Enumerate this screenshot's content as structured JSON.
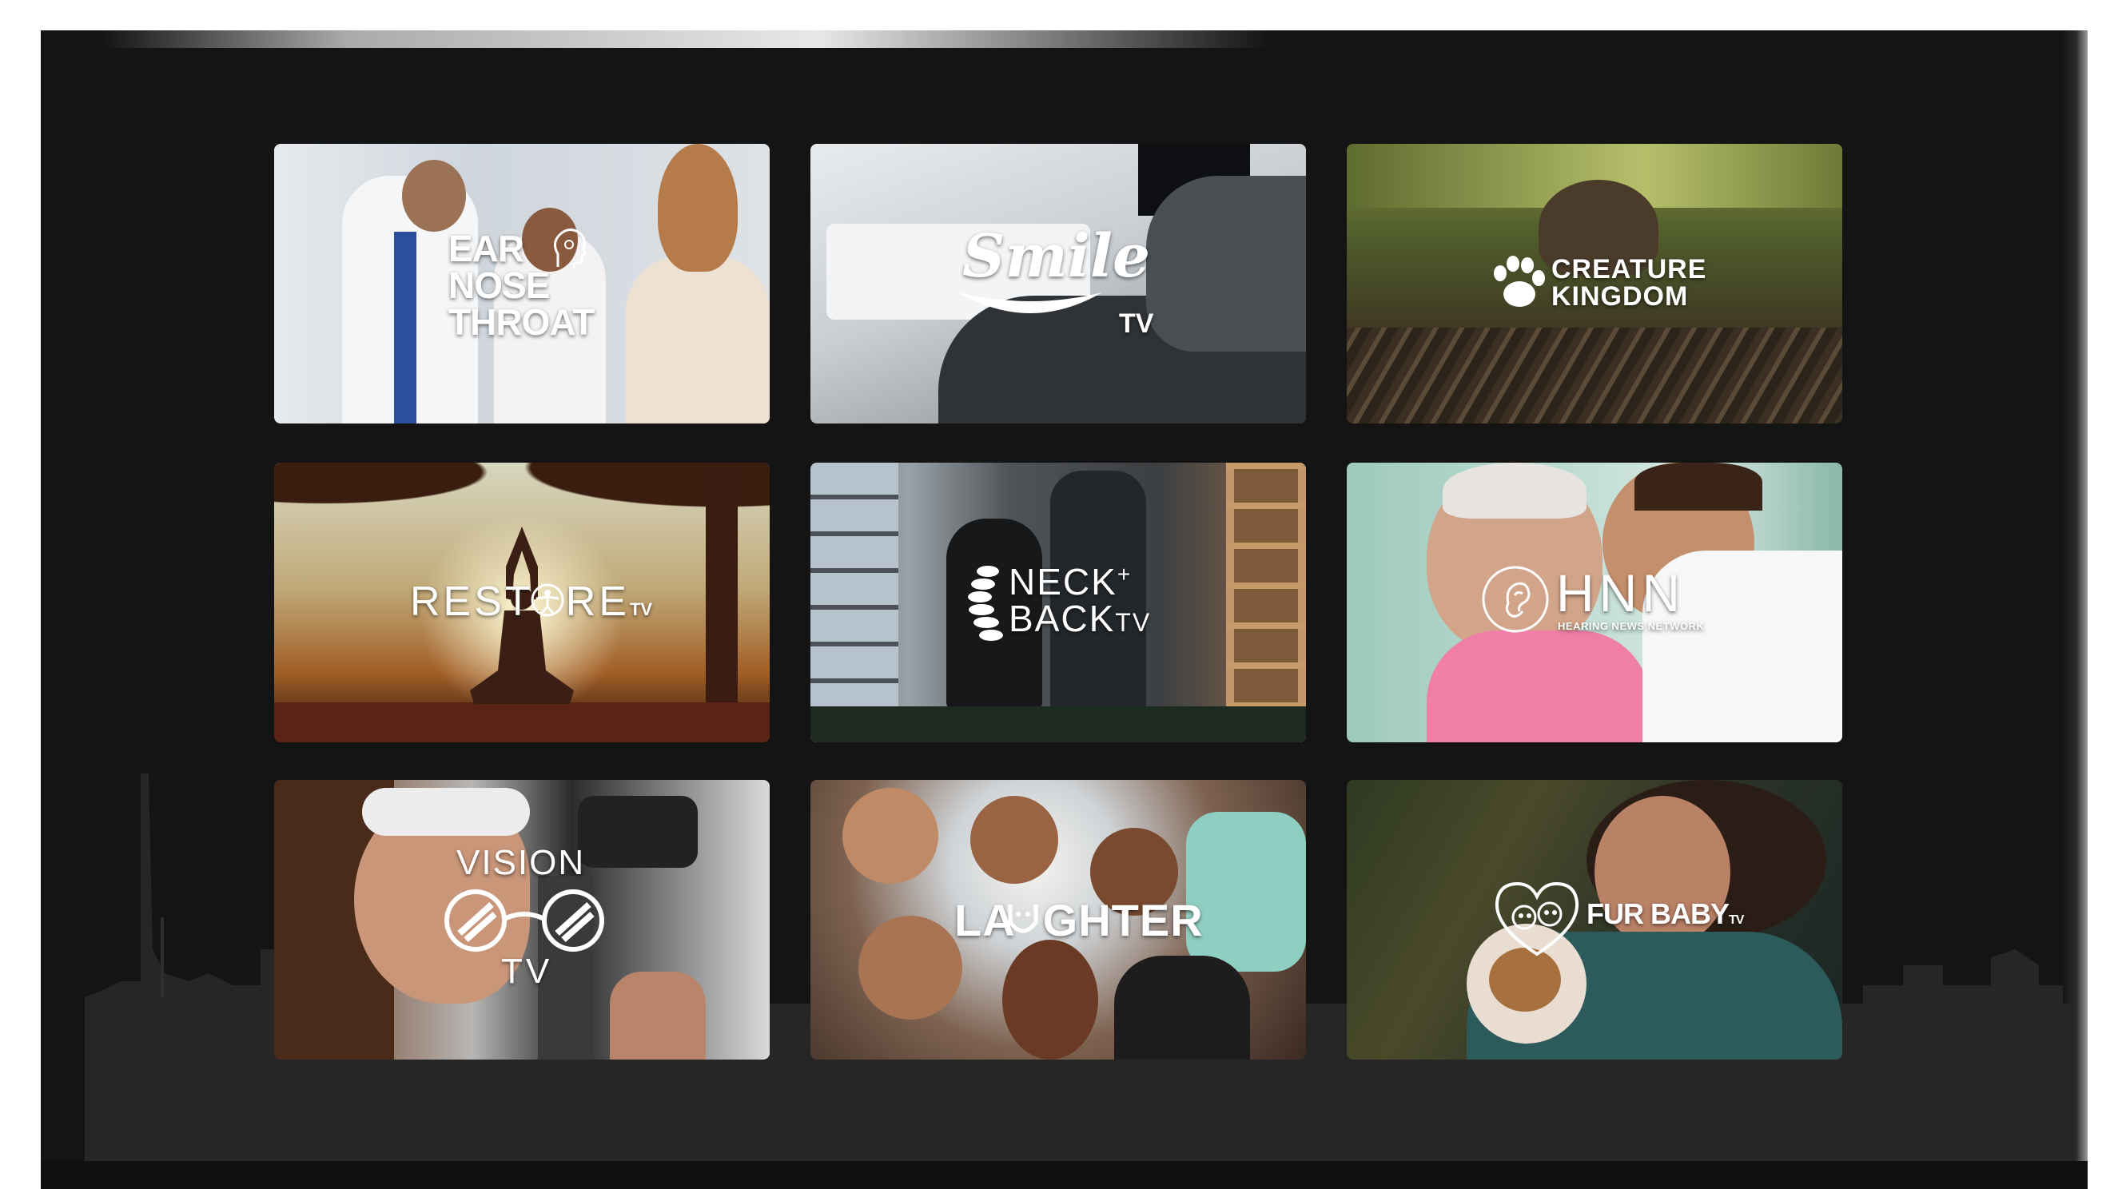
{
  "tiles": [
    {
      "lines": [
        "EAR",
        "NOSE",
        "THROAT"
      ]
    },
    {
      "script": "Smile",
      "suffix": "TV"
    },
    {
      "lines": [
        "CREATURE",
        "KINGDOM"
      ]
    },
    {
      "word_a": "REST",
      "word_b": "RE",
      "suffix": "TV"
    },
    {
      "line1": "NECK",
      "plus": "+",
      "line2": "BACK",
      "suffix": "TV"
    },
    {
      "title": "HNN",
      "subtitle": "HEARING NEWS NETWORK"
    },
    {
      "line1": "VISION",
      "line2": "TV"
    },
    {
      "word_a": "LA",
      "word_b": "GHTER"
    },
    {
      "title": "FUR BABY",
      "suffix": "TV"
    }
  ],
  "colors": {
    "screen_bg": "#141414",
    "skyline": "#2a2a2a",
    "logo_text": "#ffffff"
  }
}
